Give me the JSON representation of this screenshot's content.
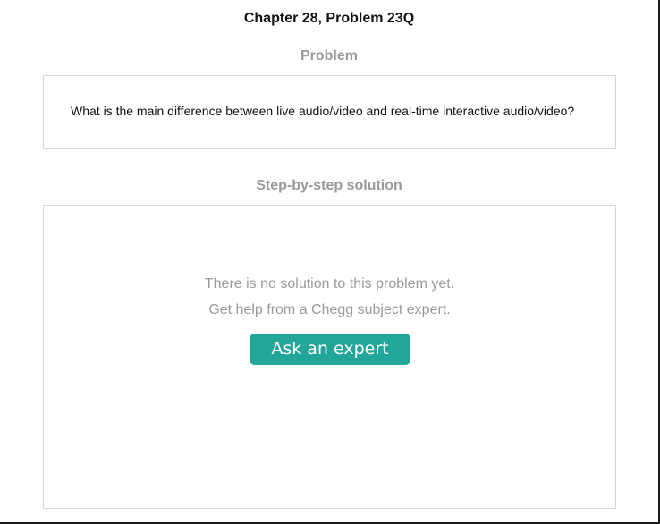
{
  "page": {
    "title": "Chapter 28, Problem 23Q"
  },
  "problem": {
    "heading": "Problem",
    "text": "What is the main difference between live audio/video and real-time interactive audio/video?"
  },
  "solution": {
    "heading": "Step-by-step solution",
    "empty_line_1": "There is no solution to this problem yet.",
    "empty_line_2": "Get help from a Chegg subject expert.",
    "button_label": "Ask an expert"
  },
  "colors": {
    "accent": "#22a69a",
    "muted_text": "#9a9a9a",
    "border": "#d8d8d8",
    "text": "#111111"
  }
}
